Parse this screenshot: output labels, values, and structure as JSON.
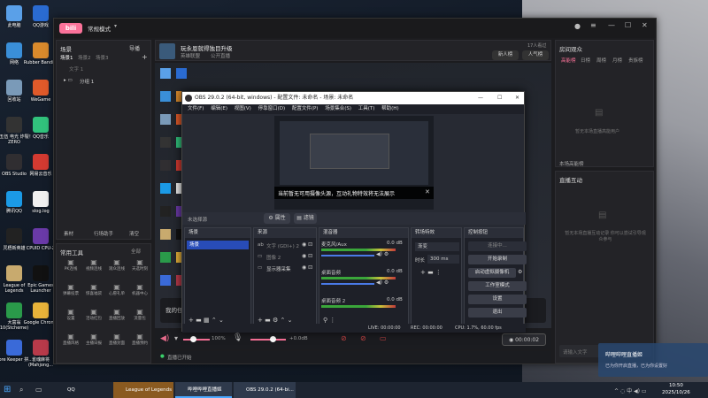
{
  "desktop": {
    "icons": [
      {
        "label": "此电脑",
        "color": "#5aa0e8"
      },
      {
        "label": "QQ游戏",
        "color": "#2a6bd1"
      },
      {
        "label": "网络",
        "color": "#3a8fd8"
      },
      {
        "label": "Rubber Bandits",
        "color": "#d98a2c"
      },
      {
        "label": "回收站",
        "color": "#7a9ab8"
      },
      {
        "label": "WeGame",
        "color": "#e05a2a"
      },
      {
        "label": "七五伍 电光 炸裂！ZERO",
        "color": "#333"
      },
      {
        "label": "QQ音乐",
        "color": "#31c27c"
      },
      {
        "label": "OBS Studio",
        "color": "#302e31"
      },
      {
        "label": "网易云音乐",
        "color": "#d33a31"
      },
      {
        "label": "腾讯QQ",
        "color": "#1b9ae6"
      },
      {
        "label": "slog.log",
        "color": "#f0f0f0"
      },
      {
        "label": "咒梧新英雄",
        "color": "#222"
      },
      {
        "label": "CPUID CPU-Z",
        "color": "#6a3aa8"
      },
      {
        "label": "League of Legends",
        "color": "#c8aa6e"
      },
      {
        "label": "Epic Games Launcher",
        "color": "#111"
      },
      {
        "label": "大富翁 10(Stcheme)",
        "color": "#2a9a4a"
      },
      {
        "label": "Google Chrome",
        "color": "#e8b33a"
      },
      {
        "label": "Core Keeper 拼...",
        "color": "#3a6ad8"
      },
      {
        "label": "雀魂麻将 (Mahjong...",
        "color": "#b83a4a"
      }
    ]
  },
  "bili": {
    "mode": "常规模式",
    "scene_panel_title": "场景",
    "import_label": "导播",
    "scene_tabs": [
      "场景1",
      "场景2",
      "场景3"
    ],
    "text_placeholder": "文字 1",
    "group_label": "分组 1",
    "bottom_tools": [
      "素材",
      "行场助手",
      "清空"
    ],
    "tools_title": "常用工具",
    "tools_all": "全部",
    "tools": [
      "PK连线",
      "视频连线",
      "观众连线",
      "天选时刻",
      "弹幕投票",
      "惊喜福袋",
      "心愿礼单",
      "机器中心",
      "设置",
      "活动红包",
      "直播回放",
      "流量包",
      "直播风格",
      "主播日报",
      "直播封面",
      "直播预约"
    ],
    "room_title": "玩永恩就得独目升级",
    "room_sub": "英雄联盟",
    "room_flag": "公开直播",
    "viewers": "17人看过",
    "new_fans": "新人榜",
    "popularity": "人气榜",
    "task_text": "我的任务",
    "volume_pct": "100%",
    "mic_db": "+0.0dB",
    "timer": "00:00:02",
    "status": "直播已开始",
    "right_title": "房间观众",
    "right_tabs": [
      "高能榜",
      "日榜",
      "周榜",
      "月榜",
      "贵族榜"
    ],
    "right_empty": "暂无本场直播高能用户",
    "rank_footer": "本场高能榜",
    "interact_title": "直播互动",
    "interact_empty": "暂无本场直播互动记录 你可以尝试引导观众参与",
    "danmu_placeholder": "请输入文字",
    "notice_title": "哔哩哔哩直播姬",
    "notice_body": "已为你开启直播，已为你设置好"
  },
  "obs": {
    "title": "OBS 29.0.2 (64-bit, windows) - 配置文件: 未命名 - 场景: 未命名",
    "menu": [
      "文件(F)",
      "编辑(E)",
      "视图(V)",
      "停靠窗口(D)",
      "配置文件(P)",
      "场景集合(S)",
      "工具(T)",
      "帮助(H)"
    ],
    "toast": "当前暂无可用摄像头源，互动礼物特效将无法展示",
    "source_none": "未选择源",
    "props_btn": "属性",
    "filter_btn": "滤镜",
    "docks": {
      "scenes": "场景",
      "sources": "来源",
      "mixer": "混音器",
      "transitions": "转场特效",
      "controls": "控制按钮"
    },
    "scene_item": "场景",
    "sources": [
      "文字 (GDI+) 2",
      "图像 2",
      "显示器采集"
    ],
    "mixer": [
      {
        "name": "麦克风/Aux",
        "db": "0.0 dB"
      },
      {
        "name": "桌面音频",
        "db": "0.0 dB"
      },
      {
        "name": "桌面音频 2",
        "db": "0.0 dB"
      }
    ],
    "transition": "渐变",
    "duration_label": "时长",
    "duration": "300 ms",
    "controls": [
      "连接中...",
      "开始录制",
      "启动虚拟摄像机",
      "工作室模式",
      "设置",
      "退出"
    ],
    "status_live": "LIVE: 00:00:00",
    "status_rec": "REC: 00:00:00",
    "status_cpu": "CPU: 1.7%, 60.00 fps"
  },
  "taskbar": {
    "items": [
      "QQ",
      "League of Legends",
      "哔哩哔哩直播姬",
      "OBS 29.0.2 (64-bi..."
    ],
    "time": "10:50",
    "date": "2025/10/26"
  },
  "colors": {
    "accent": "#fb7299",
    "obs_blue": "#284cb8",
    "live_red": "#e23b3b"
  }
}
